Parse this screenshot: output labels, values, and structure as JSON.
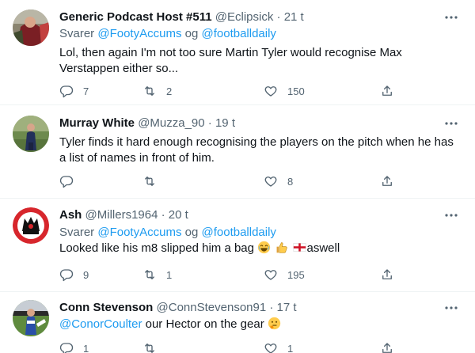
{
  "tweets": [
    {
      "name": "Generic Podcast Host #511",
      "handle": "@Eclipsick",
      "time": "21 t",
      "reply_prefix": "Svarer",
      "reply_user1": "@FootyAccums",
      "reply_joiner": "og",
      "reply_user2": "@footballdaily",
      "text": "Lol, then again I'm not too sure Martin Tyler would recognise Max Verstappen either so...",
      "replies": "7",
      "retweets": "2",
      "likes": "150"
    },
    {
      "name": "Murray White",
      "handle": "@Muzza_90",
      "time": "19 t",
      "text": "Tyler finds it hard enough recognising the players on the pitch when he has a list of names in front of him.",
      "replies": "",
      "retweets": "",
      "likes": "8"
    },
    {
      "name": "Ash",
      "handle": "@Millers1964",
      "time": "20 t",
      "reply_prefix": "Svarer",
      "reply_user1": "@FootyAccums",
      "reply_joiner": "og",
      "reply_user2": "@footballdaily",
      "text_before": "Looked like his m8 slipped him a bag",
      "text_after": "aswell",
      "replies": "9",
      "retweets": "1",
      "likes": "195"
    },
    {
      "name": "Conn Stevenson",
      "handle": "@ConnStevenson91",
      "time": "17 t",
      "mention": "@ConorCoulter",
      "text": "our Hector on the gear",
      "replies": "1",
      "retweets": "",
      "likes": "1"
    }
  ],
  "separator": "·",
  "icons": {
    "more": "more-icon",
    "reply": "reply-icon",
    "retweet": "retweet-icon",
    "like": "heart-icon",
    "share": "share-icon"
  },
  "colors": {
    "text": "#0f1419",
    "secondary": "#536471",
    "link": "#1d9bf0",
    "divider": "#eff3f4"
  }
}
